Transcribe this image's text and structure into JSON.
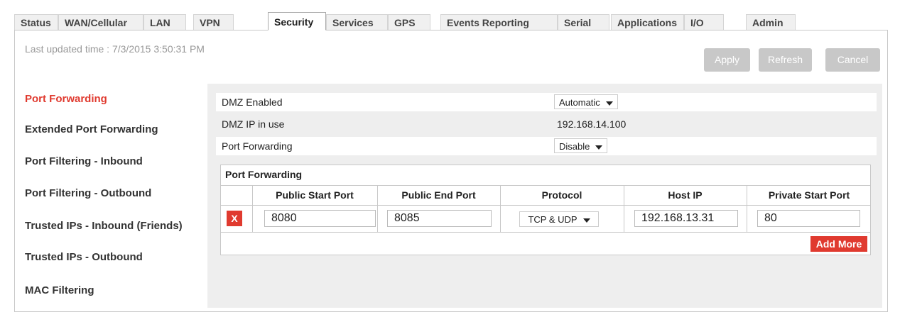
{
  "tabs": [
    {
      "label": "Status"
    },
    {
      "label": "WAN/Cellular"
    },
    {
      "label": "LAN"
    },
    {
      "label": "VPN"
    },
    {
      "label": "Security",
      "active": true
    },
    {
      "label": "Services"
    },
    {
      "label": "GPS"
    },
    {
      "label": "Events Reporting"
    },
    {
      "label": "Serial"
    },
    {
      "label": "Applications"
    },
    {
      "label": "I/O"
    },
    {
      "label": "Admin"
    }
  ],
  "header": {
    "last_updated": "Last updated time : 7/3/2015 3:50:31 PM",
    "apply_label": "Apply",
    "refresh_label": "Refresh",
    "cancel_label": "Cancel"
  },
  "sidebar": {
    "items": [
      {
        "label": "Port Forwarding",
        "active": true
      },
      {
        "label": "Extended Port Forwarding"
      },
      {
        "label": "Port Filtering - Inbound"
      },
      {
        "label": "Port Filtering - Outbound"
      },
      {
        "label": "Trusted IPs - Inbound (Friends)"
      },
      {
        "label": "Trusted IPs - Outbound"
      },
      {
        "label": "MAC Filtering"
      }
    ]
  },
  "settings": {
    "dmz_enabled_label": "DMZ Enabled",
    "dmz_enabled_value": "Automatic",
    "dmz_ip_label": "DMZ IP in use",
    "dmz_ip_value": "192.168.14.100",
    "port_forwarding_label": "Port Forwarding",
    "port_forwarding_value": "Disable"
  },
  "pf_table": {
    "title": "Port Forwarding",
    "columns": [
      "Public Start Port",
      "Public End Port",
      "Protocol",
      "Host IP",
      "Private Start Port"
    ],
    "rows": [
      {
        "delete_label": "X",
        "public_start": "8080",
        "public_end": "8085",
        "protocol": "TCP & UDP",
        "host_ip": "192.168.13.31",
        "private_start": "80"
      }
    ],
    "add_more_label": "Add More"
  },
  "colors": {
    "accent": "#e03a2f",
    "button_disabled": "#c8c8c8",
    "content_bg": "#eeeeee"
  }
}
